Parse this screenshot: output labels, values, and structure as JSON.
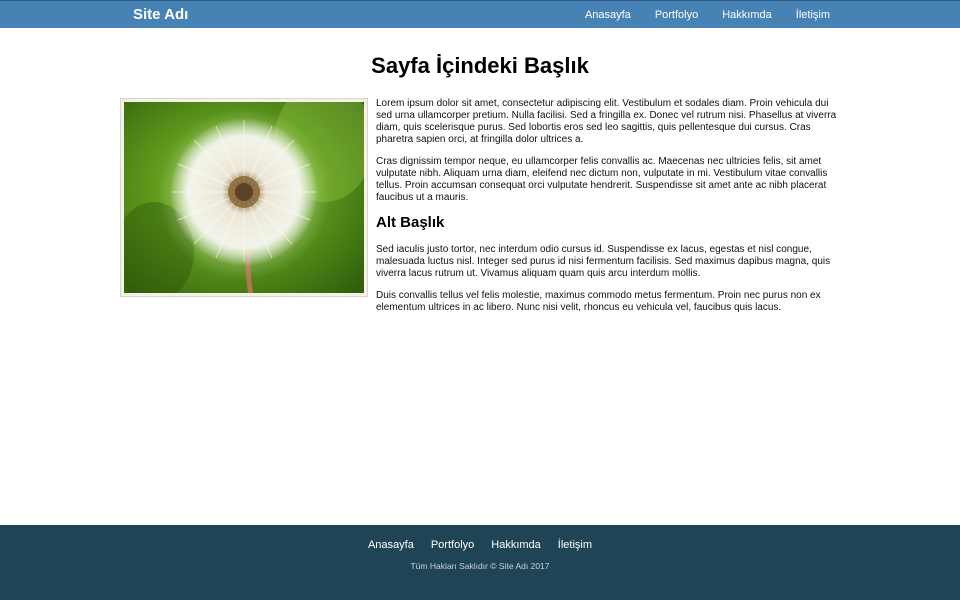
{
  "header": {
    "site_name": "Site Adı",
    "nav": [
      "Anasayfa",
      "Portfolyo",
      "Hakkımda",
      "İletişim"
    ]
  },
  "main": {
    "title": "Sayfa İçindeki Başlık",
    "image_alt": "dandelion-seed-head-photo",
    "paragraphs_top": [
      "Lorem ipsum dolor sit amet, consectetur adipiscing elit. Vestibulum et sodales diam. Proin vehicula dui sed urna ullamcorper pretium. Nulla facilisi. Sed a fringilla ex. Donec vel rutrum nisi. Phasellus at viverra diam, quis scelerisque purus. Sed lobortis eros sed leo sagittis, quis pellentesque dui cursus. Cras pharetra sapien orci, at fringilla dolor ultrices a.",
      "Cras dignissim tempor neque, eu ullamcorper felis convallis ac. Maecenas nec ultricies felis, sit amet vulputate nibh. Aliquam urna diam, eleifend nec dictum non, vulputate in mi. Vestibulum vitae convallis tellus. Proin accumsan consequat orci vulputate hendrerit. Suspendisse sit amet ante ac nibh placerat faucibus ut a mauris."
    ],
    "subtitle": "Alt Başlık",
    "paragraphs_bottom": [
      "Sed iaculis justo tortor, nec interdum odio cursus id. Suspendisse ex lacus, egestas et nisl congue, malesuada luctus nisl. Integer sed purus id nisi fermentum facilisis. Sed maximus dapibus magna, quis viverra lacus rutrum ut. Vivamus aliquam quam quis arcu interdum mollis.",
      "Duis convallis tellus vel felis molestie, maximus commodo metus fermentum. Proin nec purus non ex elementum ultrices in ac libero. Nunc nisi velit, rhoncus eu vehicula vel, faucibus quis lacus."
    ]
  },
  "footer": {
    "nav": [
      "Anasayfa",
      "Portfolyo",
      "Hakkımda",
      "İletişim"
    ],
    "copyright": "Tüm Hakları Saklıdır © Site Adı 2017"
  },
  "colors": {
    "header_bg": "#4682b4",
    "footer_bg": "#1f4455"
  }
}
